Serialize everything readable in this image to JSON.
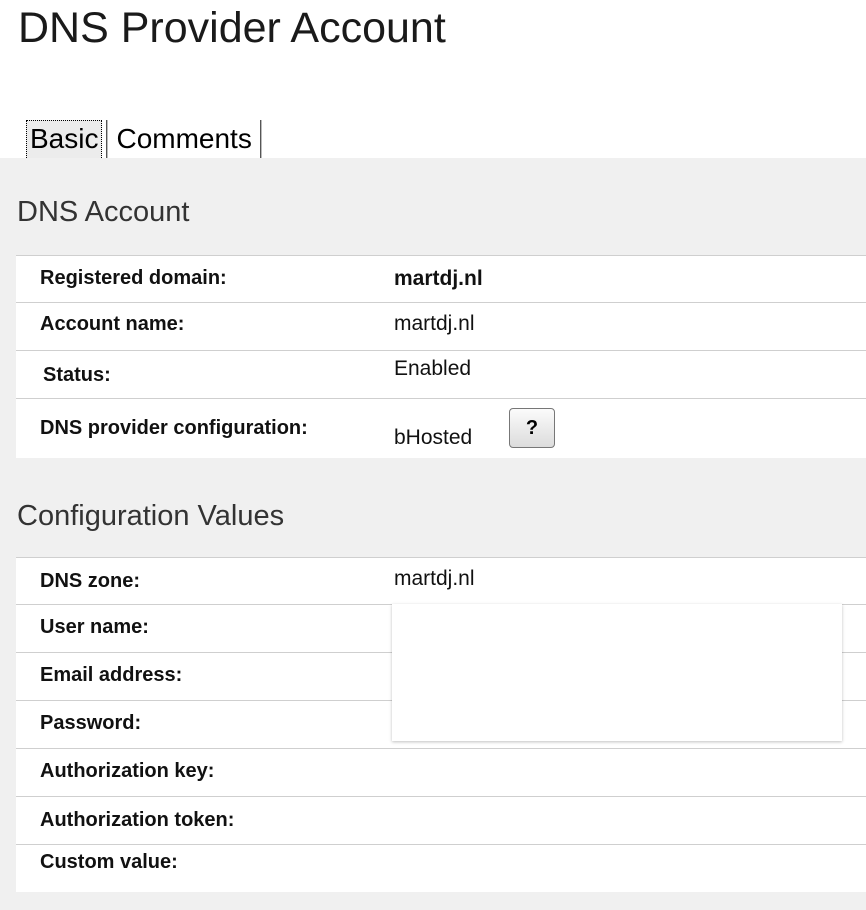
{
  "page": {
    "title": "DNS Provider Account"
  },
  "tabs": [
    {
      "label": "Basic",
      "active": true
    },
    {
      "label": "Comments",
      "active": false
    }
  ],
  "dns_account": {
    "title": "DNS Account",
    "rows": [
      {
        "label": "Registered domain:",
        "value": "martdj.nl"
      },
      {
        "label": "Account name:",
        "value": "martdj.nl"
      },
      {
        "label": "Status:",
        "value": "Enabled"
      },
      {
        "label": "DNS provider configuration:",
        "value": "bHosted",
        "help_label": "?"
      }
    ]
  },
  "config_values": {
    "title": "Configuration Values",
    "rows": [
      {
        "label": "DNS zone:",
        "value": "martdj.nl"
      },
      {
        "label": "User name:",
        "value": ""
      },
      {
        "label": "Email address:",
        "value": ""
      },
      {
        "label": "Password:",
        "value": ""
      },
      {
        "label": "Authorization key:",
        "value": ""
      },
      {
        "label": "Authorization token:",
        "value": ""
      },
      {
        "label": "Custom value:",
        "value": ""
      }
    ]
  },
  "colors": {
    "panel_background": "#f0f0f0",
    "row_background": "#ffffff",
    "row_divider": "#cfcfcf"
  }
}
